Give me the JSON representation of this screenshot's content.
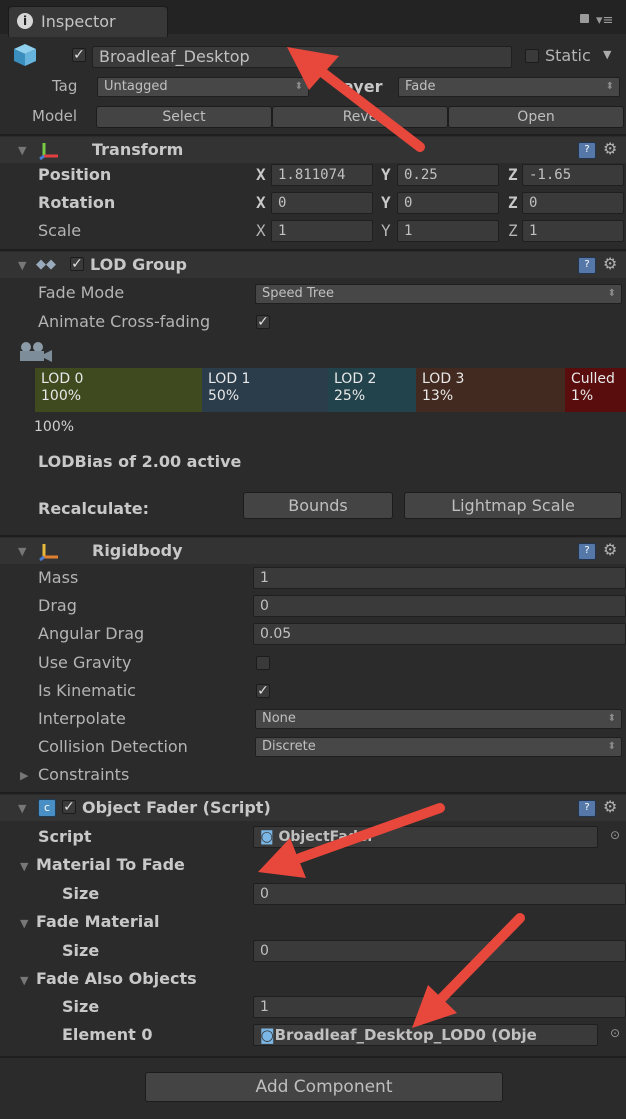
{
  "tab": {
    "title": "Inspector"
  },
  "object": {
    "name": "Broadleaf_Desktop",
    "static_label": "Static",
    "tag_label": "Tag",
    "tag_value": "Untagged",
    "layer_label": "ayer",
    "layer_value": "Fade"
  },
  "model": {
    "label": "Model",
    "select": "Select",
    "revert": "Reve",
    "open": "Open"
  },
  "transform": {
    "title": "Transform",
    "position": {
      "label": "Position",
      "x": "1.811074",
      "y": "0.25",
      "z": "-1.65"
    },
    "rotation": {
      "label": "Rotation",
      "x": "0",
      "y": "0",
      "z": "0"
    },
    "scale": {
      "label": "Scale",
      "x": "1",
      "y": "1",
      "z": "1"
    },
    "axis": {
      "x": "X",
      "y": "Y",
      "z": "Z"
    }
  },
  "lod": {
    "title": "LOD Group",
    "fade_mode_label": "Fade Mode",
    "fade_mode_value": "Speed Tree",
    "animate_label": "Animate Cross-fading",
    "segments": [
      {
        "name": "LOD 0",
        "pct": "100%",
        "color": "#3f4a1f"
      },
      {
        "name": "LOD 1",
        "pct": "50%",
        "color": "#2b3c4a"
      },
      {
        "name": "LOD 2",
        "pct": "25%",
        "color": "#22424c"
      },
      {
        "name": "LOD 3",
        "pct": "13%",
        "color": "#432a20"
      },
      {
        "name": "Culled",
        "pct": "1%",
        "color": "#5a0d0d"
      }
    ],
    "current_pct": "100%",
    "bias_text": "LODBias of 2.00 active",
    "recalculate_label": "Recalculate:",
    "bounds_button": "Bounds",
    "lightmap_button": "Lightmap Scale"
  },
  "rigidbody": {
    "title": "Rigidbody",
    "mass_label": "Mass",
    "mass": "1",
    "drag_label": "Drag",
    "drag": "0",
    "angular_label": "Angular Drag",
    "angular": "0.05",
    "gravity_label": "Use Gravity",
    "kinematic_label": "Is Kinematic",
    "interpolate_label": "Interpolate",
    "interpolate": "None",
    "collision_label": "Collision Detection",
    "collision": "Discrete",
    "constraints_label": "Constraints"
  },
  "fader": {
    "title": "Object Fader (Script)",
    "script_label": "Script",
    "script_value": "ObjectFader",
    "mat_to_fade": "Material To Fade",
    "size_label": "Size",
    "mat_to_fade_size": "0",
    "fade_material": "Fade Material",
    "fade_material_size": "0",
    "fade_also": "Fade Also Objects",
    "fade_also_size": "1",
    "element_label": "Element 0",
    "element_value": "Broadleaf_Desktop_LOD0 (Obje"
  },
  "add_component": "Add Component",
  "colors": {
    "arrow": "#e8473b",
    "panel": "#2b2b2b",
    "header": "#333333"
  }
}
